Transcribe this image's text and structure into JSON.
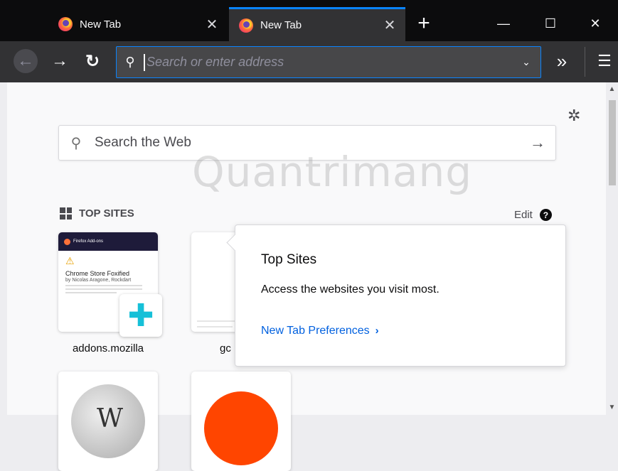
{
  "tabs": [
    {
      "title": "New Tab",
      "close": "✕"
    },
    {
      "title": "New Tab",
      "close": "✕"
    }
  ],
  "window": {
    "new_tab": "+",
    "minimize": "—",
    "maximize": "☐",
    "close": "✕"
  },
  "nav": {
    "back": "←",
    "forward": "→",
    "reload": "↻",
    "address_placeholder": "Search or enter address",
    "dropdown": "⌄",
    "overflow": "»",
    "menu": "☰"
  },
  "newtab": {
    "settings_icon": "✲",
    "web_search": {
      "placeholder": "Search the Web",
      "go": "→"
    },
    "watermark": "Quantrimang",
    "top_sites": {
      "heading": "TOP SITES",
      "edit": "Edit",
      "help": "?",
      "tiles": [
        {
          "label": "addons.mozilla",
          "preview": {
            "brand": "Firefox Add-ons",
            "heading": "Chrome Store Foxified",
            "byline": "by Nicolas Aragone, Rockdart"
          }
        },
        {
          "label": "gc"
        },
        {
          "label": ""
        },
        {
          "label": ""
        }
      ]
    },
    "popup": {
      "title": "Top Sites",
      "description": "Access the websites you visit most.",
      "link": "New Tab Preferences",
      "link_chevron": "›"
    }
  },
  "scrollbar": {
    "up": "▲",
    "down": "▼"
  }
}
